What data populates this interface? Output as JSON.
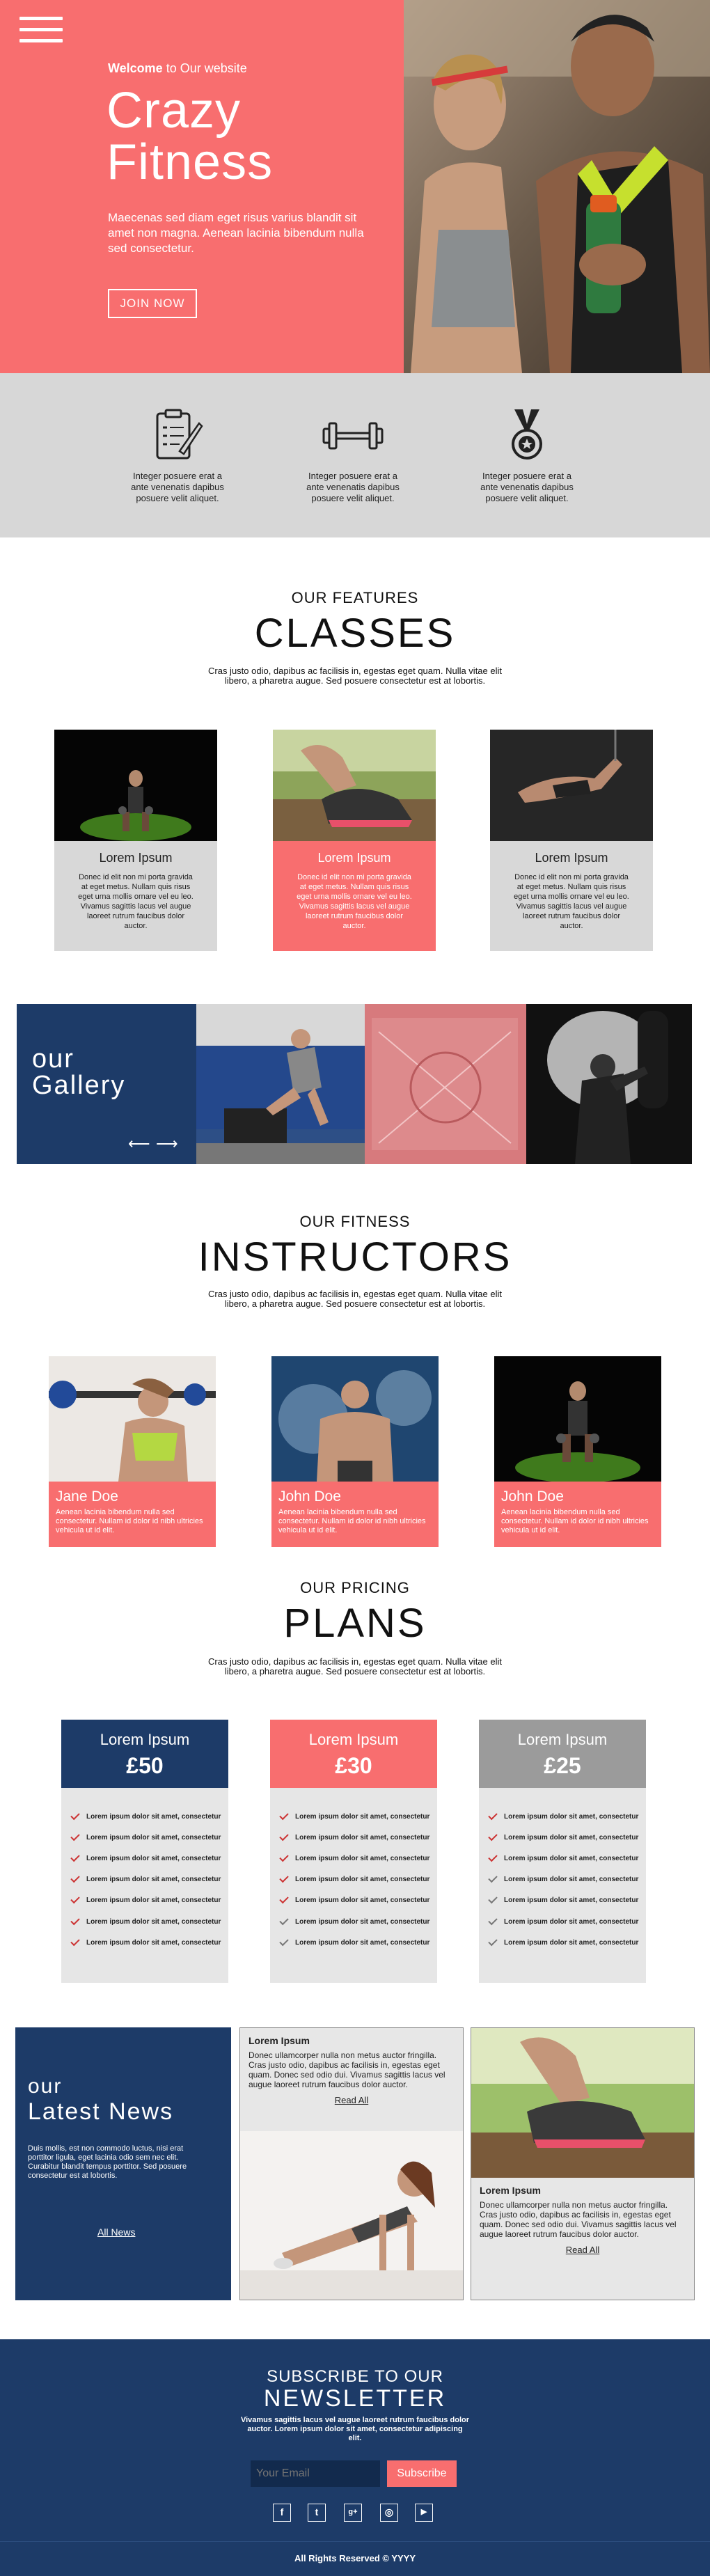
{
  "hero": {
    "welcome_bold": "Welcome",
    "welcome_rest": " to Our website",
    "title_line1": "Crazy",
    "title_line2": "Fitness",
    "text": "Maecenas sed diam eget risus varius blandit sit amet non magna. Aenean lacinia bibendum nulla sed consectetur.",
    "join_label": "JOIN NOW",
    "menu_icon": "hamburger-menu-icon"
  },
  "features": [
    {
      "icon": "clipboard-icon",
      "text": "Integer posuere erat a ante venenatis dapibus posuere velit aliquet."
    },
    {
      "icon": "dumbbell-icon",
      "text": "Integer posuere erat a ante venenatis dapibus posuere velit aliquet."
    },
    {
      "icon": "medal-icon",
      "text": "Integer posuere erat a ante venenatis dapibus posuere velit aliquet."
    }
  ],
  "classes": {
    "small": "OUR FEATURES",
    "big": "CLASSES",
    "text": "Cras justo odio, dapibus ac facilisis in, egestas eget quam. Nulla vitae elit libero, a pharetra augue. Sed posuere consectetur est at lobortis.",
    "cards": [
      {
        "title": "Lorem Ipsum",
        "text": "Donec id elit non mi porta gravida at eget metus. Nullam quis risus eget urna mollis ornare vel eu leo. Vivamus sagittis lacus vel augue laoreet rutrum faucibus dolor auctor."
      },
      {
        "title": "Lorem Ipsum",
        "text": "Donec id elit non mi porta gravida at eget metus. Nullam quis risus eget urna mollis ornare vel eu leo. Vivamus sagittis lacus vel augue laoreet rutrum faucibus dolor auctor."
      },
      {
        "title": "Lorem Ipsum",
        "text": "Donec id elit non mi porta gravida at eget metus. Nullam quis risus eget urna mollis ornare vel eu leo. Vivamus sagittis lacus vel augue laoreet rutrum faucibus dolor auctor."
      }
    ]
  },
  "gallery": {
    "line1": "our",
    "line2": "Gallery",
    "prev": "⟵",
    "next": "⟶"
  },
  "instructors": {
    "small": "OUR FITNESS",
    "big": "INSTRUCTORS",
    "text": "Cras justo odio, dapibus ac facilisis in, egestas eget quam. Nulla vitae elit libero, a pharetra augue. Sed posuere consectetur est at lobortis.",
    "people": [
      {
        "name": "Jane Doe",
        "text": "Aenean lacinia bibendum nulla sed consectetur. Nullam id dolor id nibh ultricies vehicula ut id elit."
      },
      {
        "name": "John Doe",
        "text": "Aenean lacinia bibendum nulla sed consectetur. Nullam id dolor id nibh ultricies vehicula ut id elit."
      },
      {
        "name": "John Doe",
        "text": "Aenean lacinia bibendum nulla sed consectetur. Nullam id dolor id nibh ultricies vehicula ut id elit."
      }
    ]
  },
  "plans": {
    "small": "OUR PRICING",
    "big": "PLANS",
    "text": "Cras justo odio, dapibus ac facilisis in, egestas eget quam. Nulla vitae elit libero, a pharetra augue. Sed posuere consectetur est at lobortis.",
    "items_text": "Lorem ipsum dolor sit amet, consectetur",
    "cards": [
      {
        "name": "Lorem Ipsum",
        "price": "£50",
        "color": "#1d3b68",
        "included": [
          1,
          1,
          1,
          1,
          1,
          1,
          1
        ]
      },
      {
        "name": "Lorem Ipsum",
        "price": "£30",
        "color": "#f86e6f",
        "included": [
          1,
          1,
          1,
          1,
          1,
          0,
          0
        ]
      },
      {
        "name": "Lorem Ipsum",
        "price": "£25",
        "color": "#9b9b9b",
        "included": [
          1,
          1,
          1,
          0,
          0,
          0,
          0
        ]
      }
    ]
  },
  "news": {
    "line1": "our",
    "line2": "Latest News",
    "text": "Duis mollis, est non commodo luctus, nisi erat porttitor ligula, eget lacinia odio sem nec elit. Curabitur blandit tempus porttitor. Sed posuere consectetur est at lobortis.",
    "all_link": "All News",
    "card1": {
      "title": "Lorem Ipsum",
      "text": "Donec ullamcorper nulla non metus auctor fringilla. Cras justo odio, dapibus ac facilisis in, egestas eget quam. Donec sed odio dui. Vivamus sagittis lacus vel augue laoreet rutrum faucibus dolor auctor.",
      "link": "Read All"
    },
    "card2": {
      "title": "Lorem Ipsum",
      "text": "Donec ullamcorper nulla non metus auctor fringilla. Cras justo odio, dapibus ac facilisis in, egestas eget quam. Donec sed odio dui. Vivamus sagittis lacus vel augue laoreet rutrum faucibus dolor auctor.",
      "link": "Read All"
    }
  },
  "newsletter": {
    "small": "SUBSCRIBE TO OUR",
    "big": "NEWSLETTER",
    "text": "Vivamus sagittis lacus vel augue laoreet rutrum faucibus dolor auctor. Lorem ipsum dolor sit amet, consectetur adipiscing elit.",
    "placeholder": "Your Email",
    "button": "Subscribe",
    "social": [
      {
        "icon": "facebook-icon",
        "glyph": "f"
      },
      {
        "icon": "twitter-icon",
        "glyph": "t"
      },
      {
        "icon": "google-plus-icon",
        "glyph": "g+"
      },
      {
        "icon": "instagram-icon",
        "glyph": "◎"
      },
      {
        "icon": "youtube-icon",
        "glyph": "▶"
      }
    ]
  },
  "footer": {
    "text": "All Rights Reserved © YYYY"
  },
  "colors": {
    "pink": "#f86e6f",
    "navy": "#1d3b68",
    "grey": "#d7d7d7"
  }
}
